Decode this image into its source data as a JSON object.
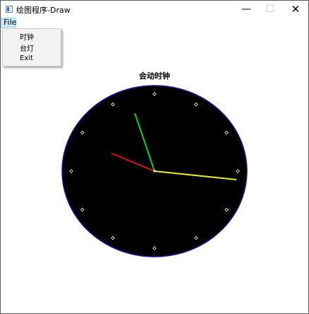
{
  "window": {
    "title": "绘图程序-Draw"
  },
  "controls": {
    "minimize": "—",
    "maximize": "☐",
    "close": "✕"
  },
  "menubar": {
    "file": "File"
  },
  "file_menu": {
    "items": [
      "时钟",
      "台灯",
      "Exit"
    ]
  },
  "clock": {
    "title": "会动时钟",
    "face_color": "#000000",
    "rim_color": "#1a1a9c",
    "marker_color": "#ffffff",
    "hands": {
      "hour": {
        "color": "#e01010"
      },
      "minute": {
        "color": "#10d010"
      },
      "second": {
        "color": "#f0f020"
      }
    }
  }
}
